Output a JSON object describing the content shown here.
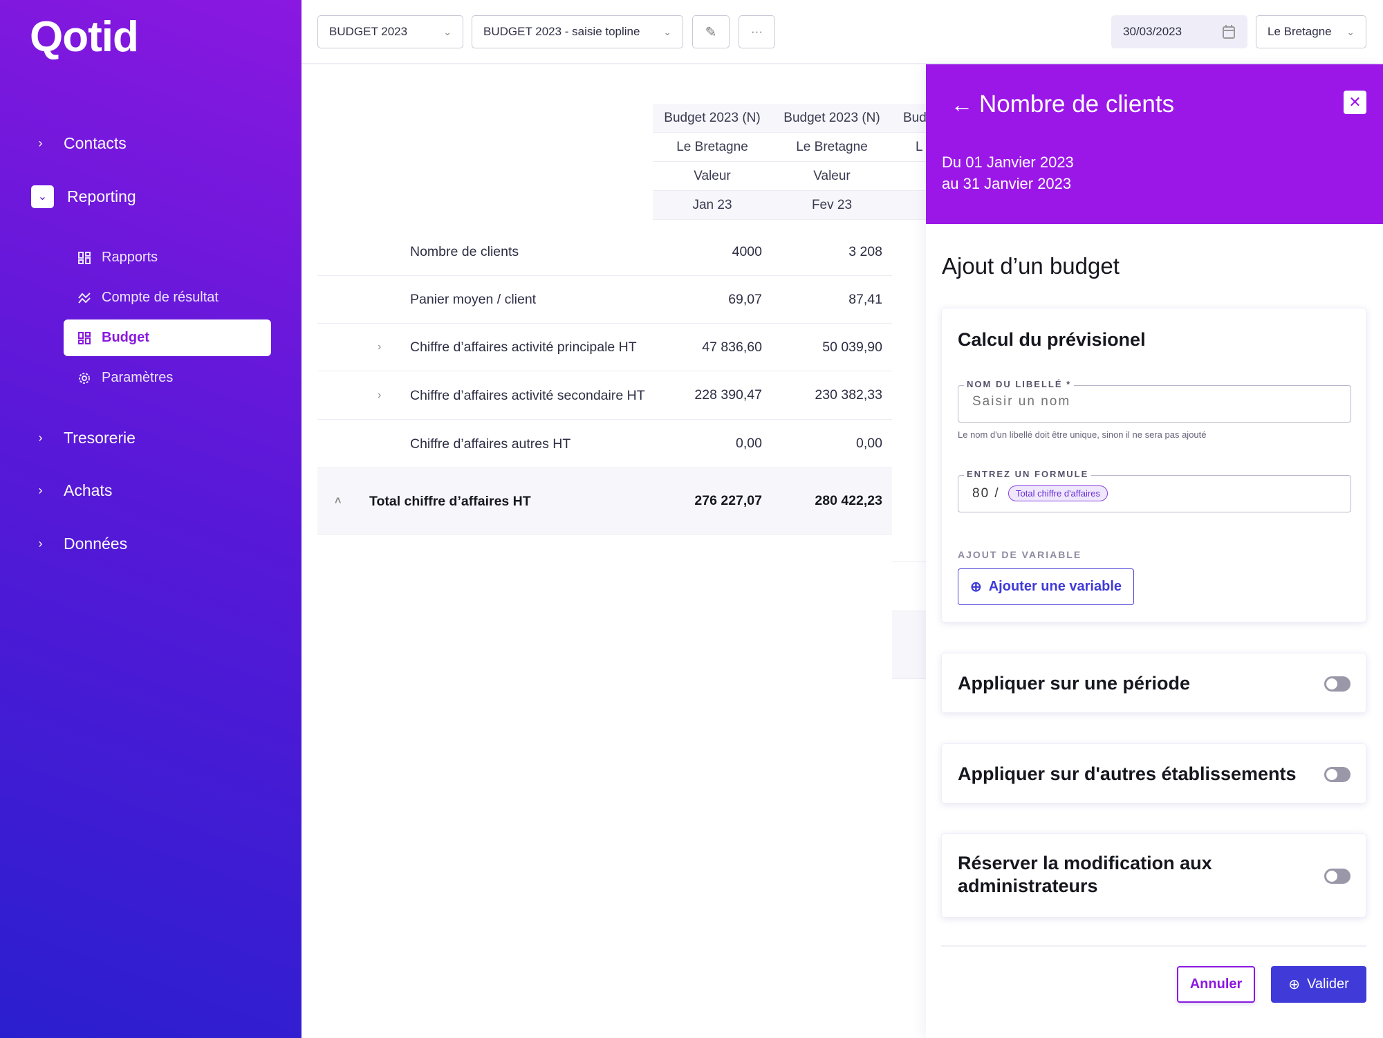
{
  "sidebar": {
    "logo": "Qotid",
    "items": [
      {
        "label": "Contacts",
        "icon": "chevron-right-icon"
      },
      {
        "label": "Reporting",
        "icon": "chevron-down-icon",
        "expanded": true,
        "children": [
          {
            "label": "Rapports",
            "icon": "grid-icon"
          },
          {
            "label": "Compte de résultat",
            "icon": "trend-icon"
          },
          {
            "label": "Budget",
            "icon": "grid-icon",
            "active": true
          },
          {
            "label": "Paramètres",
            "icon": "gear-icon"
          }
        ]
      },
      {
        "label": "Tresorerie",
        "icon": "chevron-right-icon"
      },
      {
        "label": "Achats",
        "icon": "chevron-right-icon"
      },
      {
        "label": "Données",
        "icon": "chevron-right-icon"
      }
    ]
  },
  "toolbar": {
    "budget_select": "BUDGET 2023",
    "version_select": "BUDGET 2023 - saisie topline",
    "date": "30/03/2023",
    "site_select": "Le Bretagne"
  },
  "table": {
    "columns": [
      {
        "h1": "Budget 2023 (N)",
        "h2": "Le Bretagne",
        "h3": "Valeur",
        "h4": "Jan 23"
      },
      {
        "h1": "Budget 2023 (N)",
        "h2": "Le Bretagne",
        "h3": "Valeur",
        "h4": "Fev 23"
      },
      {
        "h1": "Bud",
        "h2": "L"
      }
    ],
    "rows": [
      {
        "label": "Nombre de clients",
        "values": [
          "4000",
          "3 208"
        ]
      },
      {
        "label": "Panier moyen / client",
        "values": [
          "69,07",
          "87,41"
        ]
      },
      {
        "label": "Chiffre d’affaires activité principale HT",
        "values": [
          "47 836,60",
          "50 039,90"
        ],
        "expandable": true
      },
      {
        "label": "Chiffre d’affaires activité secondaire HT",
        "values": [
          "228 390,47",
          "230 382,33"
        ],
        "expandable": true
      },
      {
        "label": "Chiffre d’affaires autres HT",
        "values": [
          "0,00",
          "0,00"
        ]
      }
    ],
    "total": {
      "label": "Total chiffre d’affaires HT",
      "values": [
        "276 227,07",
        "280 422,23"
      ]
    }
  },
  "panel": {
    "title": "Nombre de clients",
    "date_from": "Du 01 Janvier 2023",
    "date_to": "au 31 Janvier 2023",
    "header_color": "#9b17e8",
    "section_title": "Ajout d’un budget",
    "calc": {
      "title": "Calcul du prévisionel",
      "name_label": "NOM DU LIBELLÉ *",
      "name_placeholder": "Saisir un nom",
      "name_value": "",
      "name_help": "Le nom d'un libellé doit être unique, sinon il ne sera pas ajouté",
      "formula_label": "ENTREZ UN FORMULE",
      "formula_prefix": "80 /",
      "formula_chip": "Total chiffre d'affaires",
      "variable_label": "AJOUT DE VARIABLE",
      "add_variable": "Ajouter une variable"
    },
    "toggles": [
      {
        "label": "Appliquer sur une période",
        "on": false
      },
      {
        "label": "Appliquer sur d'autres établissements",
        "on": false
      },
      {
        "label": "Réserver la modification aux administrateurs",
        "on": false
      }
    ],
    "cancel": "Annuler",
    "submit": "Valider",
    "accent": "#3f3ad8"
  }
}
